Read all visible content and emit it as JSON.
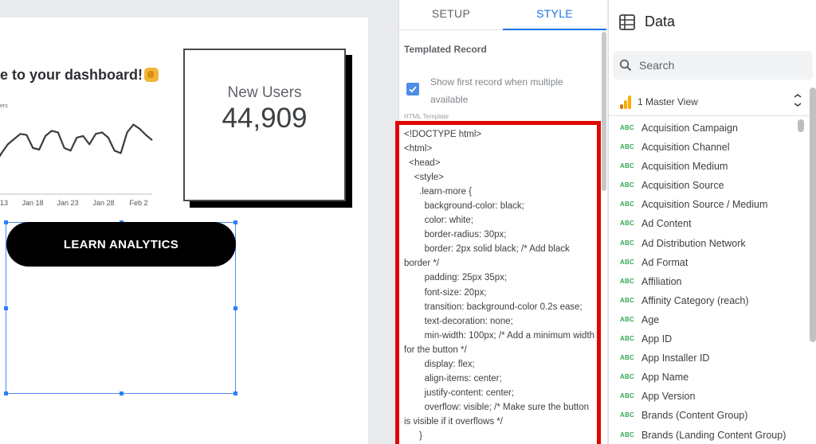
{
  "canvas": {
    "welcome_text": "e to your dashboard!",
    "legend_fragment": "ers",
    "chart_data": {
      "type": "line",
      "title": "",
      "xlabel": "",
      "ylabel": "",
      "x_ticks": [
        "13",
        "Jan 18",
        "Jan 23",
        "Jan 28",
        "Feb 2"
      ],
      "series": [
        {
          "values": [
            0.25,
            0.45,
            0.62,
            0.72,
            0.82,
            0.8,
            0.55,
            0.52,
            0.78,
            0.88,
            0.85,
            0.55,
            0.5,
            0.75,
            0.78,
            0.62,
            0.82,
            0.85,
            0.75,
            0.5,
            0.45,
            0.85,
            1.0,
            0.92,
            0.8,
            0.7
          ]
        }
      ],
      "ylim": [
        0,
        1.1
      ],
      "line_color": "#3c3c3c"
    },
    "scorecard": {
      "label": "New Users",
      "value": "44,909"
    },
    "learn_button": {
      "label": "LEARN ANALYTICS"
    }
  },
  "properties": {
    "tabs": [
      {
        "label": "SETUP",
        "active": false
      },
      {
        "label": "STYLE",
        "active": true
      }
    ],
    "section_title": "Templated Record",
    "checkbox": {
      "label": "Show first record when multiple available",
      "checked": true
    },
    "html_template_label": "HTML Template",
    "code": "<!DOCTYPE html>\n<html>\n  <head>\n    <style>\n      .learn-more {\n        background-color: black;\n        color: white;\n        border-radius: 30px;\n        border: 2px solid black; /* Add black border */\n        padding: 25px 35px;\n        font-size: 20px;\n        transition: background-color 0.2s ease;\n        text-decoration: none;\n        min-width: 100px; /* Add a minimum width for the button */\n        display: flex;\n        align-items: center;\n        justify-content: center;\n        overflow: visible; /* Make sure the button is visible if it overflows */\n      }"
  },
  "data_panel": {
    "title": "Data",
    "search_placeholder": "Search",
    "source_name": "1 Master View",
    "fields": [
      {
        "type": "ABC",
        "name": "Acquisition Campaign"
      },
      {
        "type": "ABC",
        "name": "Acquisition Channel"
      },
      {
        "type": "ABC",
        "name": "Acquisition Medium"
      },
      {
        "type": "ABC",
        "name": "Acquisition Source"
      },
      {
        "type": "ABC",
        "name": "Acquisition Source / Medium"
      },
      {
        "type": "ABC",
        "name": "Ad Content"
      },
      {
        "type": "ABC",
        "name": "Ad Distribution Network"
      },
      {
        "type": "ABC",
        "name": "Ad Format"
      },
      {
        "type": "ABC",
        "name": "Affiliation"
      },
      {
        "type": "ABC",
        "name": "Affinity Category (reach)"
      },
      {
        "type": "ABC",
        "name": "Age"
      },
      {
        "type": "ABC",
        "name": "App ID"
      },
      {
        "type": "ABC",
        "name": "App Installer ID"
      },
      {
        "type": "ABC",
        "name": "App Name"
      },
      {
        "type": "ABC",
        "name": "App Version"
      },
      {
        "type": "ABC",
        "name": "Brands (Content Group)"
      },
      {
        "type": "ABC",
        "name": "Brands (Landing Content Group)"
      }
    ]
  },
  "colors": {
    "accent": "#1a73e8",
    "highlight_border": "#e10600",
    "field_type": "#34a853",
    "checkbox": "#4e8de8"
  }
}
